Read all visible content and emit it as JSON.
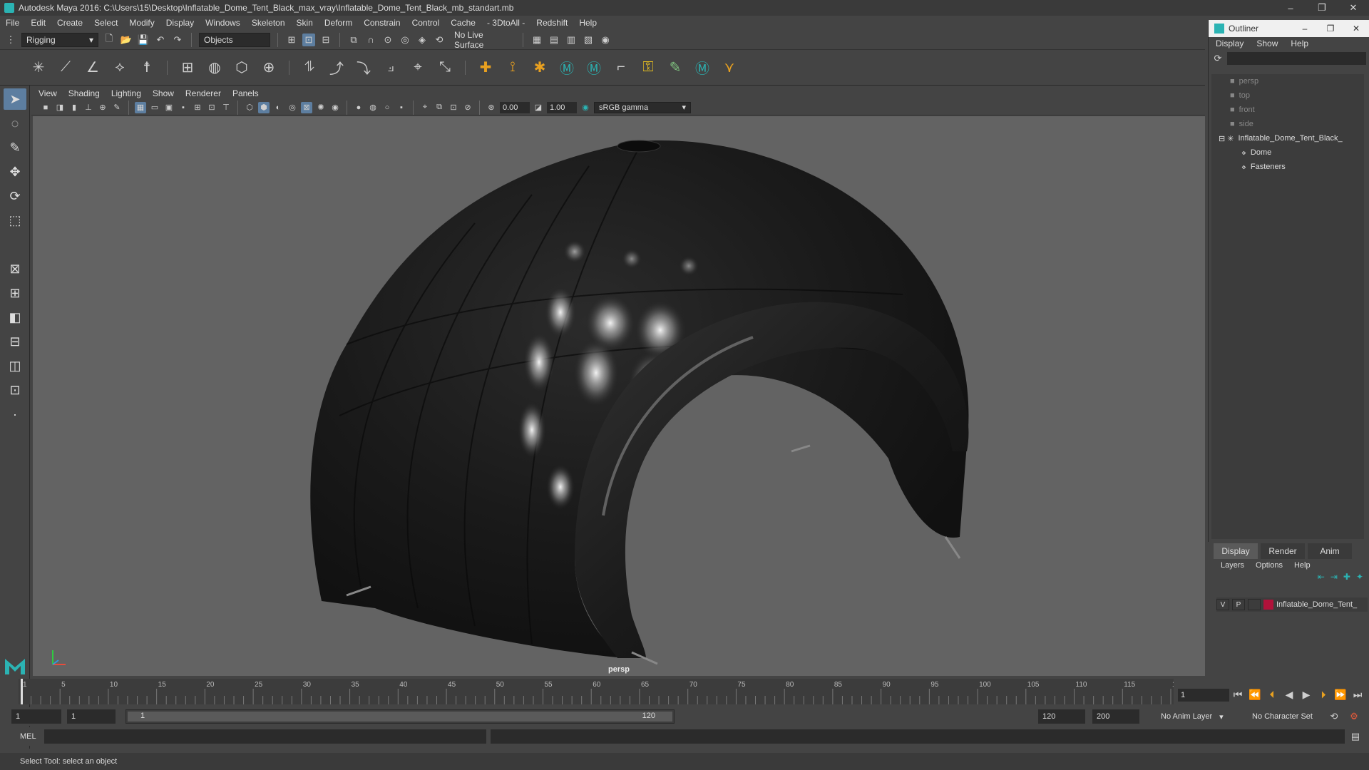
{
  "window": {
    "title": "Autodesk Maya 2016: C:\\Users\\15\\Desktop\\Inflatable_Dome_Tent_Black_max_vray\\Inflatable_Dome_Tent_Black_mb_standart.mb",
    "minimize": "–",
    "maximize": "❐",
    "close": "✕"
  },
  "menubar": [
    "File",
    "Edit",
    "Create",
    "Select",
    "Modify",
    "Display",
    "Windows",
    "Skeleton",
    "Skin",
    "Deform",
    "Constrain",
    "Control",
    "Cache",
    "- 3DtoAll -",
    "Redshift",
    "Help"
  ],
  "statusline": {
    "menuset": "Rigging",
    "selection_mode": "Objects",
    "live_surface": "No Live Surface"
  },
  "panel": {
    "menus": [
      "View",
      "Shading",
      "Lighting",
      "Show",
      "Renderer",
      "Panels"
    ],
    "exposure": "0.00",
    "gamma": "1.00",
    "color_space": "sRGB gamma",
    "camera_label": "persp"
  },
  "timeline": {
    "ticks": [
      1,
      5,
      10,
      15,
      20,
      25,
      30,
      35,
      40,
      45,
      50,
      55,
      60,
      65,
      70,
      75,
      80,
      85,
      90,
      95,
      100,
      105,
      110,
      115,
      120
    ],
    "current_frame": "1"
  },
  "range": {
    "start": "1",
    "playback_start": "1",
    "slider_start": "1",
    "slider_end": "120",
    "playback_end": "120",
    "end": "200",
    "anim_layer": "No Anim Layer",
    "character_set": "No Character Set"
  },
  "cmdline": {
    "label": "MEL"
  },
  "helpline": {
    "text": "Select Tool: select an object"
  },
  "outliner": {
    "title": "Outliner",
    "menus": [
      "Display",
      "Show",
      "Help"
    ],
    "items": [
      {
        "label": "persp",
        "dim": true,
        "indent": 1
      },
      {
        "label": "top",
        "dim": true,
        "indent": 1
      },
      {
        "label": "front",
        "dim": true,
        "indent": 1
      },
      {
        "label": "side",
        "dim": true,
        "indent": 1
      },
      {
        "label": "Inflatable_Dome_Tent_Black_",
        "dim": false,
        "indent": 0
      },
      {
        "label": "Dome",
        "dim": false,
        "indent": 2
      },
      {
        "label": "Fasteners",
        "dim": false,
        "indent": 2
      }
    ]
  },
  "layers": {
    "tabs": [
      "Display",
      "Render",
      "Anim"
    ],
    "menus": [
      "Layers",
      "Options",
      "Help"
    ],
    "row": {
      "v": "V",
      "p": "P",
      "name": "Inflatable_Dome_Tent_",
      "color": "#b0123a"
    }
  },
  "colors": {
    "accent": "#5d7ea0",
    "viewport_bg": "#636363",
    "maya_teal": "#2bb3b3"
  }
}
